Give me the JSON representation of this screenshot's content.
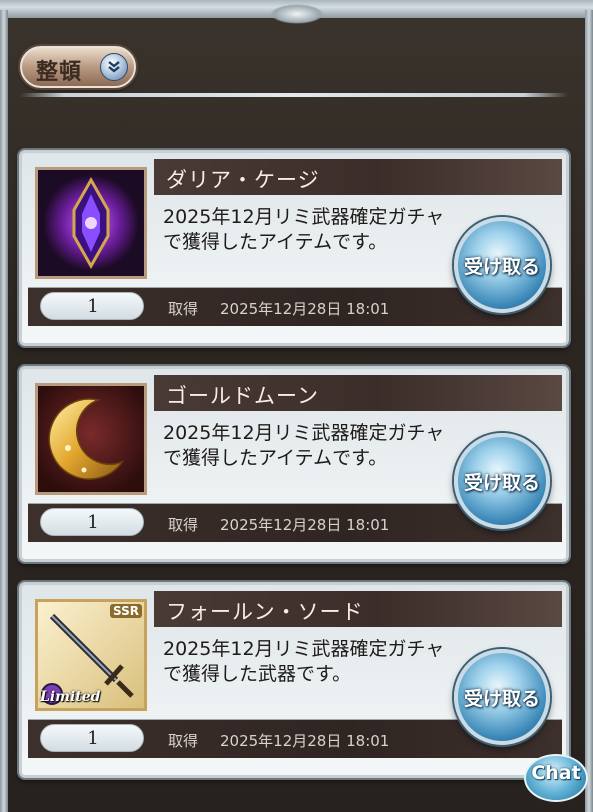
{
  "header": {
    "sort_label": "整頓"
  },
  "items": [
    {
      "name": "ダリア・ケージ",
      "description": "2025年12月リミ武器確定ガチャで獲得したアイテムです。",
      "quantity": "1",
      "acquired_label": "取得",
      "acquired_date": "2025年12月28日 18:01",
      "receive_label": "受け取る",
      "icon": "purple-crystal-icon"
    },
    {
      "name": "ゴールドムーン",
      "description": "2025年12月リミ武器確定ガチャで獲得したアイテムです。",
      "quantity": "1",
      "acquired_label": "取得",
      "acquired_date": "2025年12月28日 18:01",
      "receive_label": "受け取る",
      "icon": "gold-moon-icon"
    },
    {
      "name": "フォールン・ソード",
      "description": "2025年12月リミ武器確定ガチャで獲得した武器です。",
      "quantity": "1",
      "acquired_label": "取得",
      "acquired_date": "2025年12月28日 18:01",
      "receive_label": "受け取る",
      "icon": "sword-icon",
      "rarity": "SSR",
      "badge": "Limited"
    }
  ],
  "chat": {
    "label": "Chat"
  },
  "colors": {
    "background": "#2a2520",
    "title_bar": "#3b2d29",
    "receive_button": "#3b88b8"
  }
}
